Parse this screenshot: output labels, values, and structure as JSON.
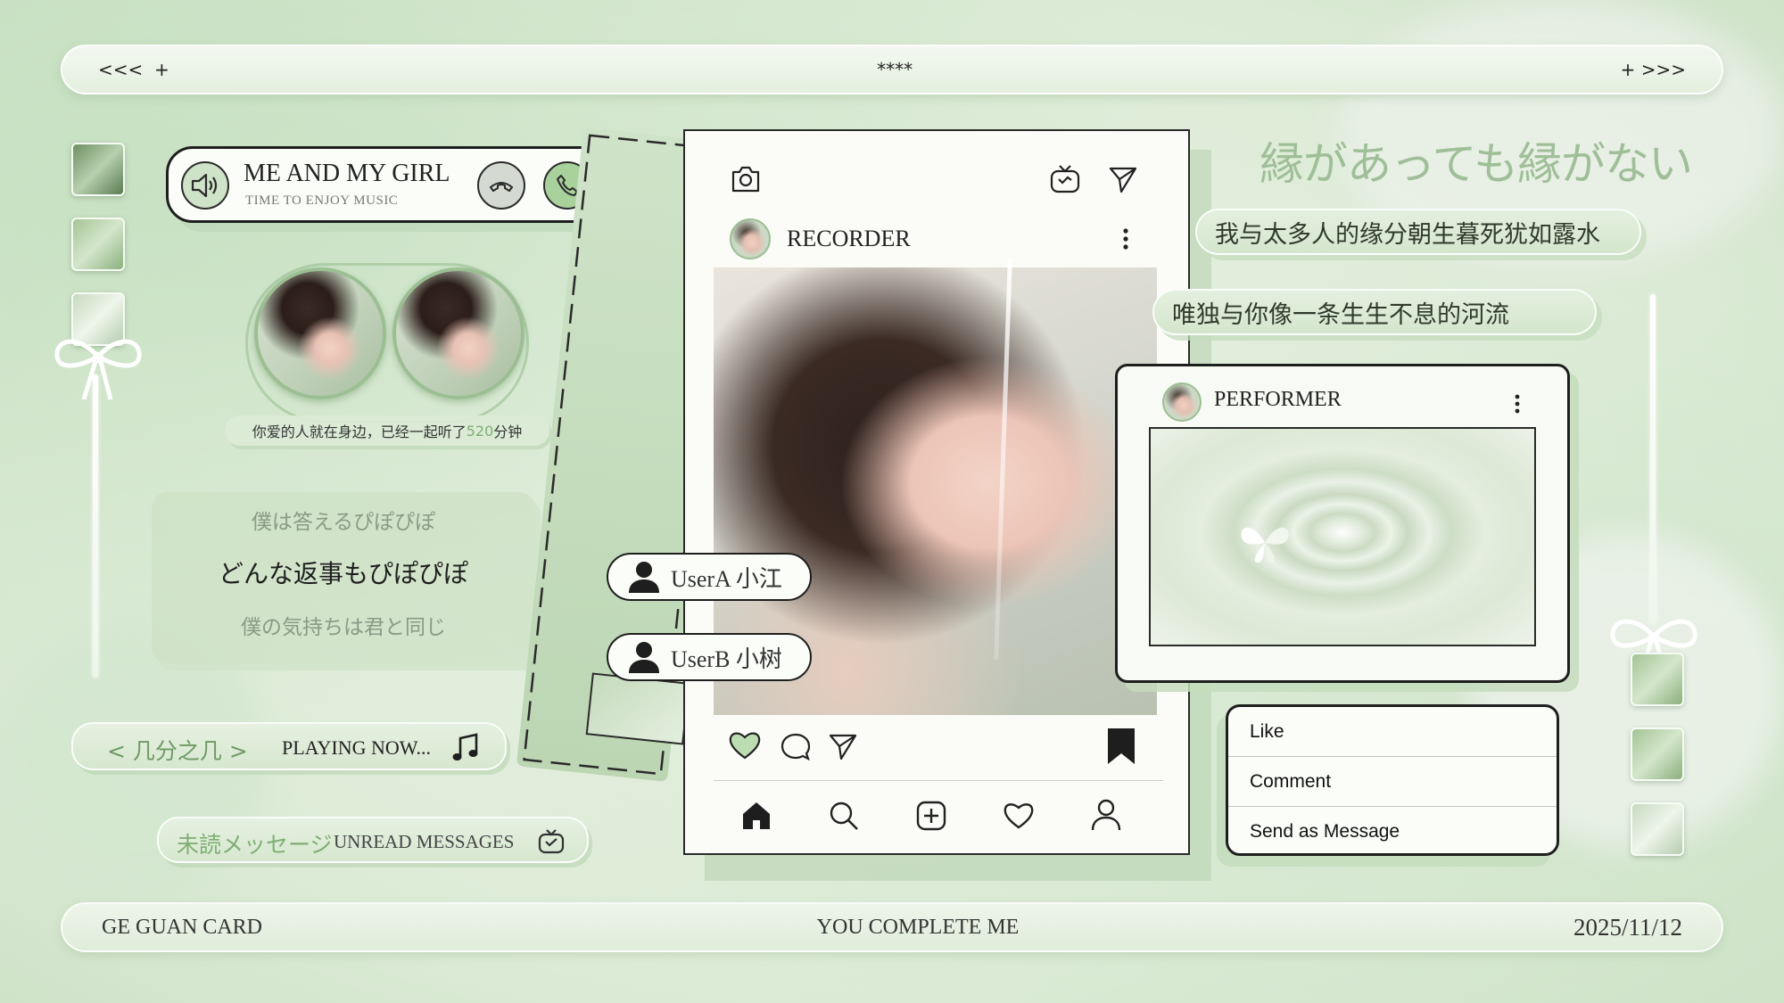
{
  "topbar": {
    "left": "<<<  +",
    "center": "****",
    "right": "+ >>>"
  },
  "music": {
    "title": "ME AND MY GIRL",
    "subtitle": "TIME TO ENJOY MUSIC"
  },
  "couple": {
    "caption_prefix": "你爱的人就在身边，已经一起听了",
    "minutes": "520",
    "caption_suffix": "分钟"
  },
  "lyrics_card": {
    "line1": "僕は答えるぴぽぴぽ",
    "line2": "どんな返事もぴぽぴぽ",
    "line3": "僕の気持ちは君と同じ"
  },
  "player": {
    "title": "< 几分之几 >",
    "status": "PLAYING NOW..."
  },
  "unread": {
    "jp": "未読メッセージ",
    "en": "UNREAD MESSAGES"
  },
  "bottombar": {
    "left": "GE GUAN CARD",
    "center": "YOU COMPLETE ME",
    "right": "2025/11/12"
  },
  "post": {
    "username": "RECORDER"
  },
  "users": [
    {
      "label": "UserA 小江"
    },
    {
      "label": "UserB 小树"
    }
  ],
  "heading_jp": "縁があっても縁がない",
  "lyric_pills": [
    "我与太多人的缘分朝生暮死犹如露水",
    "唯独与你像一条生生不息的河流"
  ],
  "performer": {
    "username": "PERFORMER"
  },
  "menu": {
    "items": [
      "Like",
      "Comment",
      "Send as Message"
    ]
  },
  "colors": {
    "accent": "#9bbf92",
    "accent_text": "#6f9a66",
    "outline": "#1e1e1e",
    "panel": "#fbfdf9"
  }
}
